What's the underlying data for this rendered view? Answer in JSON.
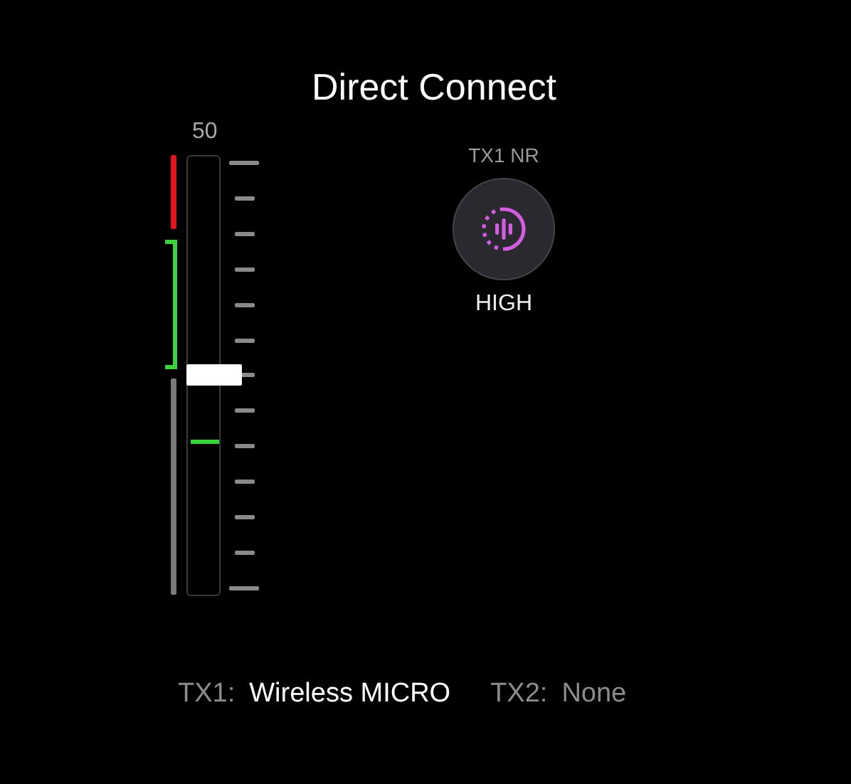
{
  "title": "Direct Connect",
  "gain": {
    "value": "50",
    "level": 0.5
  },
  "meter": {
    "level": 0.35
  },
  "noise_reduction": {
    "label": "TX1 NR",
    "value": "HIGH"
  },
  "transmitters": [
    {
      "label": "TX1:",
      "device": "Wireless MICRO",
      "connected": true
    },
    {
      "label": "TX2:",
      "device": "None",
      "connected": false
    }
  ]
}
